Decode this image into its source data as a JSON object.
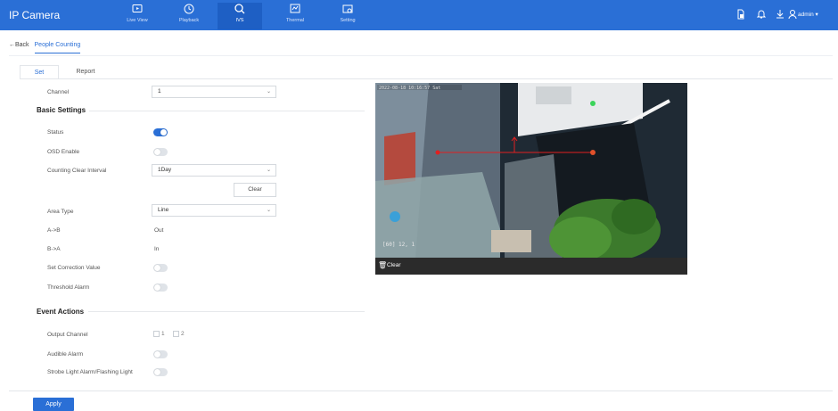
{
  "app": {
    "title": "IP Camera"
  },
  "nav": [
    {
      "label": "Live View",
      "icon": "live-view-icon"
    },
    {
      "label": "Playback",
      "icon": "playback-icon"
    },
    {
      "label": "IVS",
      "icon": "ivs-icon"
    },
    {
      "label": "Thermal",
      "icon": "thermal-icon"
    },
    {
      "label": "Setting",
      "icon": "setting-icon"
    }
  ],
  "topbar_right": {
    "user": "admin ▾"
  },
  "breadcrumb": {
    "back": "←Back",
    "current": "People Counting"
  },
  "tabs": [
    {
      "label": "Set"
    },
    {
      "label": "Report"
    }
  ],
  "form": {
    "channel_label": "Channel",
    "channel_value": "1",
    "basic_settings": "Basic Settings",
    "status_label": "Status",
    "status_on": true,
    "osd_label": "OSD Enable",
    "osd_on": false,
    "clear_interval_label": "Counting Clear Interval",
    "clear_interval_value": "1Day",
    "clear_button": "Clear",
    "area_type_label": "Area Type",
    "area_type_value": "Line",
    "ab_label": "A->B",
    "ab_value": "Out",
    "ba_label": "B->A",
    "ba_value": "In",
    "correction_label": "Set Correction Value",
    "correction_on": false,
    "threshold_label": "Threshold Alarm",
    "threshold_on": false,
    "event_actions": "Event Actions",
    "output_channel_label": "Output Channel",
    "output_channels": [
      "1",
      "2"
    ],
    "audible_label": "Audible Alarm",
    "audible_on": false,
    "strobe_label": "Strobe Light Alarm/Flashing Light",
    "strobe_on": false
  },
  "video": {
    "osd_counter": "[60] 12, 1",
    "clear_label": "Clear"
  },
  "footer": {
    "apply": "Apply"
  },
  "colors": {
    "accent": "#2a6fd6"
  }
}
